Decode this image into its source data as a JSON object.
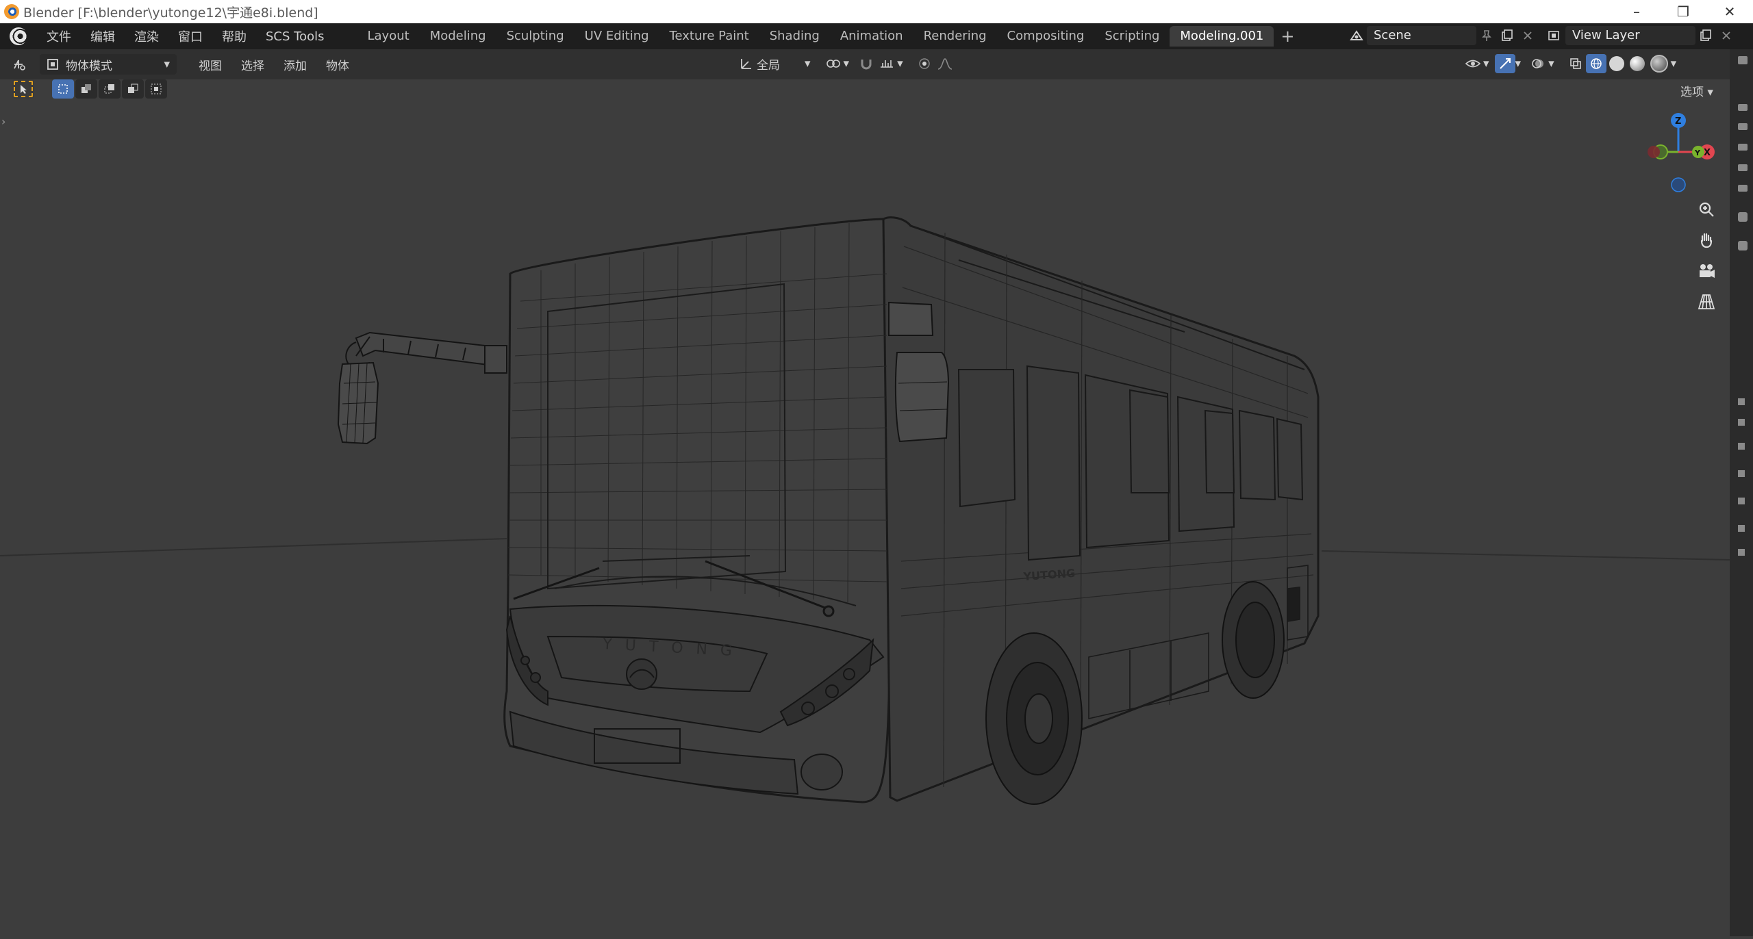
{
  "window": {
    "title": "Blender [F:\\blender\\yutonge12\\宇通e8i.blend]",
    "minimize": "–",
    "maximize": "❐",
    "close": "✕"
  },
  "menu": [
    "文件",
    "编辑",
    "渲染",
    "窗口",
    "帮助",
    "SCS Tools"
  ],
  "workspaces": [
    {
      "label": "Layout",
      "active": false
    },
    {
      "label": "Modeling",
      "active": false
    },
    {
      "label": "Sculpting",
      "active": false
    },
    {
      "label": "UV Editing",
      "active": false
    },
    {
      "label": "Texture Paint",
      "active": false
    },
    {
      "label": "Shading",
      "active": false
    },
    {
      "label": "Animation",
      "active": false
    },
    {
      "label": "Rendering",
      "active": false
    },
    {
      "label": "Compositing",
      "active": false
    },
    {
      "label": "Scripting",
      "active": false
    },
    {
      "label": "Modeling.001",
      "active": true
    }
  ],
  "add_workspace": "+",
  "scene": {
    "name": "Scene",
    "view_layer": "View Layer"
  },
  "header": {
    "mode": "物体模式",
    "view_menus": [
      "视图",
      "选择",
      "添加",
      "物体"
    ],
    "transform_orientation": "全局",
    "options": "选项"
  },
  "gizmo": {
    "z": "Z",
    "x": "X",
    "y": "Y"
  },
  "bus": {
    "brand": "Y U T O N G",
    "side_logo": "YUTONG"
  },
  "colors": {
    "accent": "#4772b3",
    "axis_x": "#e24650",
    "axis_y": "#7ab32d",
    "axis_z": "#2f7fe0",
    "background": "#3d3d3d"
  }
}
